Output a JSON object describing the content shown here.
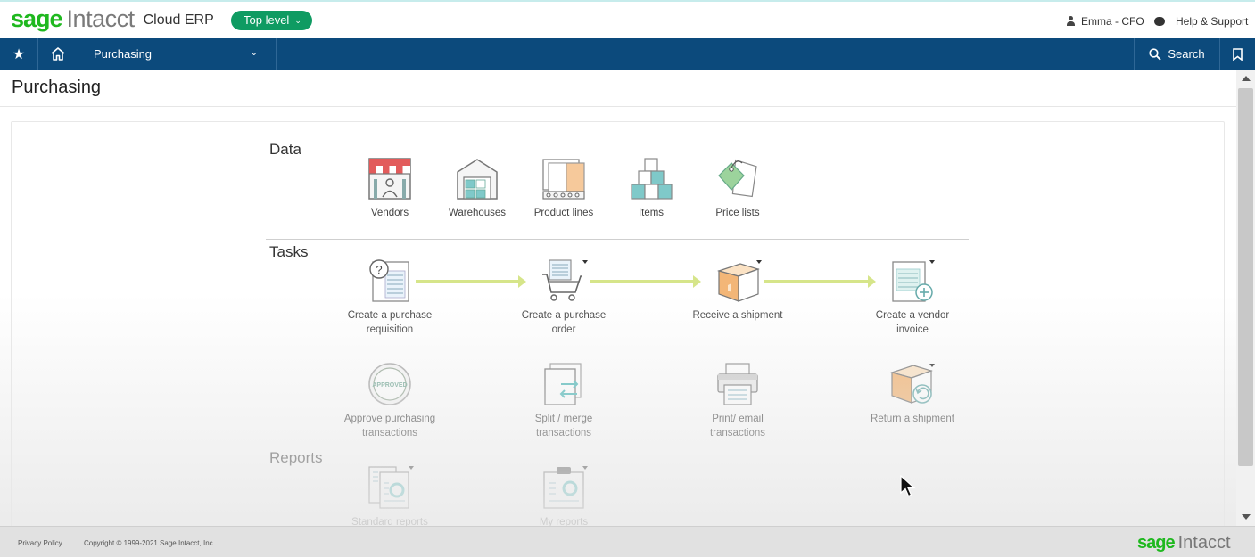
{
  "brand": {
    "sage": "sage",
    "intacct": "Intacct",
    "product": "Cloud ERP",
    "level_label": "Top level",
    "brand_green": "#1fb81f"
  },
  "header": {
    "user": "Emma - CFO",
    "help": "Help & Support"
  },
  "nav": {
    "module": "Purchasing",
    "search": "Search",
    "nav_color": "#0c4a7c"
  },
  "page": {
    "title": "Purchasing"
  },
  "sections": {
    "data": "Data",
    "tasks": "Tasks",
    "reports": "Reports"
  },
  "data_items": [
    {
      "label": "Vendors",
      "icon": "vendor-storefront-icon"
    },
    {
      "label": "Warehouses",
      "icon": "warehouse-icon"
    },
    {
      "label": "Product lines",
      "icon": "product-lines-icon"
    },
    {
      "label": "Items",
      "icon": "items-boxes-icon"
    },
    {
      "label": "Price lists",
      "icon": "price-tag-icon"
    }
  ],
  "tasks": {
    "row1": [
      {
        "label_1": "Create a purchase",
        "label_2": "requisition",
        "icon": "requisition-icon"
      },
      {
        "label_1": "Create a purchase",
        "label_2": "order",
        "icon": "shopping-cart-icon"
      },
      {
        "label_1": "Receive a shipment",
        "label_2": "",
        "icon": "box-icon"
      },
      {
        "label_1": "Create a vendor",
        "label_2": "invoice",
        "icon": "invoice-add-icon"
      }
    ],
    "row2": [
      {
        "label_1": "Approve purchasing",
        "label_2": "transactions",
        "icon": "approved-stamp-icon",
        "stamp": "APPROVED"
      },
      {
        "label_1": "Split / merge",
        "label_2": "transactions",
        "icon": "split-merge-icon"
      },
      {
        "label_1": "Print/ email",
        "label_2": "transactions",
        "icon": "printer-icon"
      },
      {
        "label_1": "Return a shipment",
        "label_2": "",
        "icon": "return-box-icon"
      }
    ]
  },
  "reports": [
    {
      "label": "Standard reports",
      "icon": "standard-reports-icon"
    },
    {
      "label": "My reports",
      "icon": "my-reports-icon"
    }
  ],
  "footer": {
    "privacy": "Privacy Policy",
    "copyright": "Copyright © 1999-2021 Sage Intacct, Inc.",
    "logo_sage": "sage",
    "logo_intacct": "Intacct"
  }
}
